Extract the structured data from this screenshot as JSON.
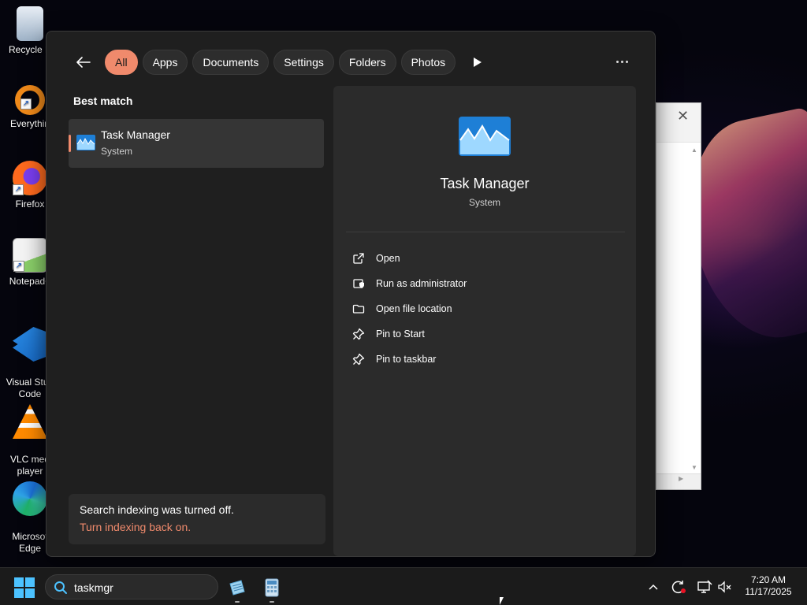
{
  "desktop": {
    "icons": [
      {
        "label": "Recycle B",
        "icon": "recycle-bin-icon"
      },
      {
        "label": "Everythin",
        "icon": "everything-icon"
      },
      {
        "label": "Firefox",
        "icon": "firefox-icon"
      },
      {
        "label": "Notepad+",
        "icon": "notepad-plus-plus-icon"
      },
      {
        "label": "Visual Stud\nCode",
        "icon": "vscode-icon"
      },
      {
        "label": "VLC med\nplayer",
        "icon": "vlc-icon"
      },
      {
        "label": "Microsof\nEdge",
        "icon": "edge-icon"
      }
    ]
  },
  "search_panel": {
    "filters": [
      "All",
      "Apps",
      "Documents",
      "Settings",
      "Folders",
      "Photos"
    ],
    "active_filter": "All",
    "best_match_label": "Best match",
    "result": {
      "title": "Task Manager",
      "subtitle": "System"
    },
    "notice": {
      "text": "Search indexing was turned off.",
      "link": "Turn indexing back on."
    },
    "preview": {
      "title": "Task Manager",
      "subtitle": "System",
      "actions": [
        {
          "label": "Open",
          "icon": "open-external-icon"
        },
        {
          "label": "Run as administrator",
          "icon": "shield-admin-icon"
        },
        {
          "label": "Open file location",
          "icon": "folder-icon"
        },
        {
          "label": "Pin to Start",
          "icon": "pin-icon"
        },
        {
          "label": "Pin to taskbar",
          "icon": "pin-icon"
        }
      ]
    },
    "accent_color": "#f08a6c"
  },
  "taskbar": {
    "search_value": "taskmgr",
    "clock": {
      "time": "7:20 AM",
      "date": "11/17/2025"
    }
  }
}
